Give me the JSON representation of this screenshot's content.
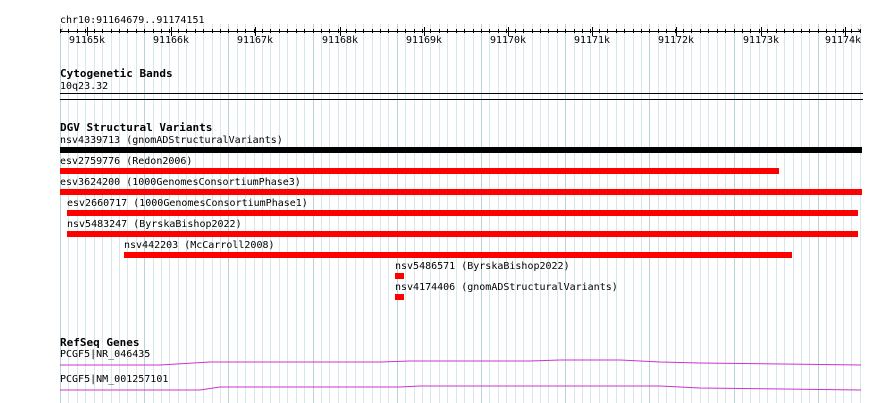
{
  "ruler": {
    "location": "chr10:91164679..91174151",
    "tick_labels": [
      "91165k",
      "91166k",
      "91167k",
      "91168k",
      "91169k",
      "91170k",
      "91171k",
      "91172k",
      "91173k",
      "91174k"
    ]
  },
  "cytobands": {
    "title": "Cytogenetic Bands",
    "band": "10q23.32"
  },
  "structural_variants": {
    "title": "DGV Structural Variants",
    "items": [
      {
        "label": "nsv4339713 (gnomADStructuralVariants)",
        "color": "#000000"
      },
      {
        "label": "esv2759776 (Redon2006)",
        "color": "#ff0000"
      },
      {
        "label": "esv3624200 (1000GenomesConsortiumPhase3)",
        "color": "#ff0000"
      },
      {
        "label": "esv2660717 (1000GenomesConsortiumPhase1)",
        "color": "#ff0000"
      },
      {
        "label": "nsv5483247 (ByrskaBishop2022)",
        "color": "#ff0000"
      },
      {
        "label": "nsv442203 (McCarroll2008)",
        "color": "#ff0000"
      },
      {
        "label": "nsv5486571 (ByrskaBishop2022)",
        "color": "#ff0000"
      },
      {
        "label": "nsv4174406 (gnomADStructuralVariants)",
        "color": "#ff0000"
      }
    ]
  },
  "refseq": {
    "title": "RefSeq Genes",
    "genes": [
      {
        "label": "PCGF5|NR_046435",
        "color": "#cc33cc"
      },
      {
        "label": "PCGF5|NM_001257101",
        "color": "#cc33cc"
      }
    ]
  }
}
